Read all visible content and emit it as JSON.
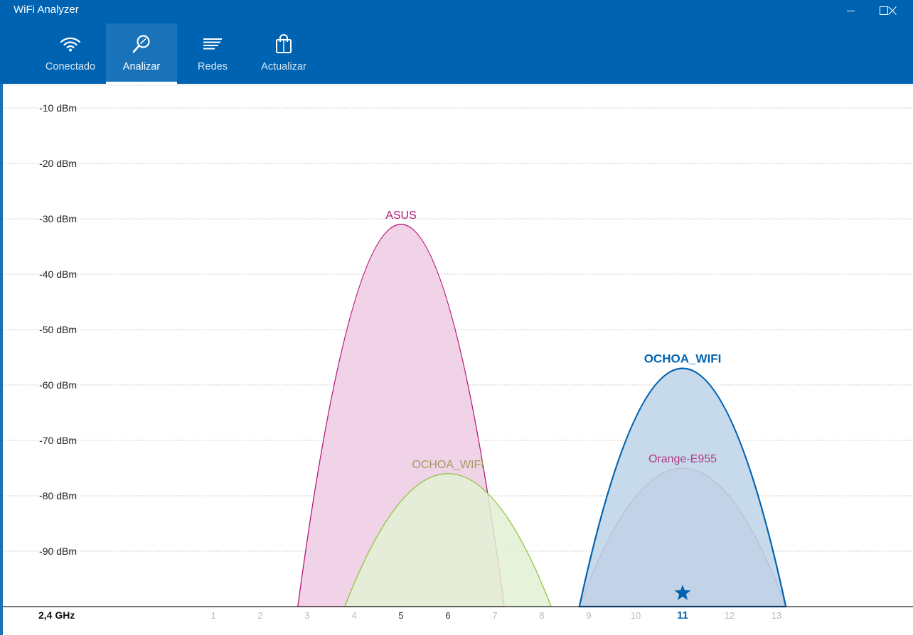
{
  "window": {
    "title": "WiFi Analyzer"
  },
  "nav": {
    "items": [
      {
        "label": "Conectado",
        "icon": "wifi-icon",
        "active": false
      },
      {
        "label": "Analizar",
        "icon": "magnifier-icon",
        "active": true
      },
      {
        "label": "Redes",
        "icon": "list-lines-icon",
        "active": false
      },
      {
        "label": "Actualizar",
        "icon": "shopping-bag-icon",
        "active": false
      }
    ]
  },
  "colors": {
    "accent": "#0063b1",
    "asus": "#b5177a",
    "ochoa_wifi_ch6": "#8cc63e",
    "ochoa_wifi_ch11": "#0063b1",
    "orange_e955": "#b03a87"
  },
  "chart_data": {
    "type": "area",
    "band_label": "2,4 GHz",
    "x_ticks": [
      1,
      2,
      3,
      4,
      5,
      6,
      7,
      8,
      9,
      10,
      11,
      12,
      13
    ],
    "highlighted_channel": 11,
    "y_ticks": [
      "-10 dBm",
      "-20 dBm",
      "-30 dBm",
      "-40 dBm",
      "-50 dBm",
      "-60 dBm",
      "-70 dBm",
      "-80 dBm",
      "-90 dBm"
    ],
    "ylim": [
      -100,
      -6
    ],
    "grid": true,
    "connected_marker": "star-icon",
    "series": [
      {
        "name": "ASUS",
        "center_channel": 5,
        "span_channels": [
          2.8,
          7.2
        ],
        "signal_dbm": -31,
        "color": "#b5177a",
        "fill": "#efcbe4"
      },
      {
        "name": "OCHOA_WIFI",
        "center_channel": 6,
        "span_channels": [
          3.8,
          8.2
        ],
        "signal_dbm": -76,
        "color": "#8cc63e",
        "fill": "#e3f0d3",
        "label_color": "#a29a5f"
      },
      {
        "name": "Orange-E955",
        "center_channel": 11,
        "span_channels": [
          8.8,
          13.2
        ],
        "signal_dbm": -75,
        "color": "#b03a87",
        "fill": "#e9cadf"
      },
      {
        "name": "OCHOA_WIFI",
        "center_channel": 11,
        "span_channels": [
          8.8,
          13.2
        ],
        "signal_dbm": -57,
        "color": "#0063b1",
        "fill": "#bcd3e8",
        "connected": true,
        "bold": true
      }
    ]
  }
}
